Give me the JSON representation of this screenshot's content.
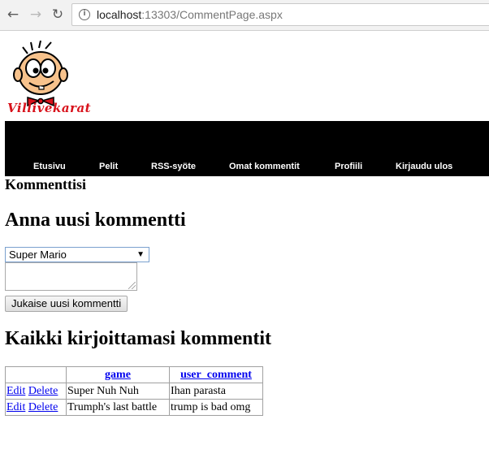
{
  "browser": {
    "url_host": "localhost",
    "url_rest": ":13303/CommentPage.aspx"
  },
  "logo": {
    "text": "Villivekarat"
  },
  "nav": {
    "items": [
      "Etusivu",
      "Pelit",
      "RSS-syöte",
      "Omat kommentit",
      "Profiili",
      "Kirjaudu ulos"
    ]
  },
  "page": {
    "title": "Kommenttisi",
    "new_heading": "Anna uusi kommentti",
    "game_select_value": "Super Mario",
    "comment_value": "",
    "submit_label": "Jukaise uusi kommentti",
    "all_heading": "Kaikki kirjoittamasi kommentit"
  },
  "table": {
    "headers": [
      "",
      "game",
      "user_comment"
    ],
    "edit_label": "Edit",
    "delete_label": "Delete",
    "rows": [
      {
        "game": "Super Nuh Nuh",
        "comment": "Ihan parasta"
      },
      {
        "game": "Trumph's last battle",
        "comment": "trump is bad omg"
      }
    ]
  }
}
